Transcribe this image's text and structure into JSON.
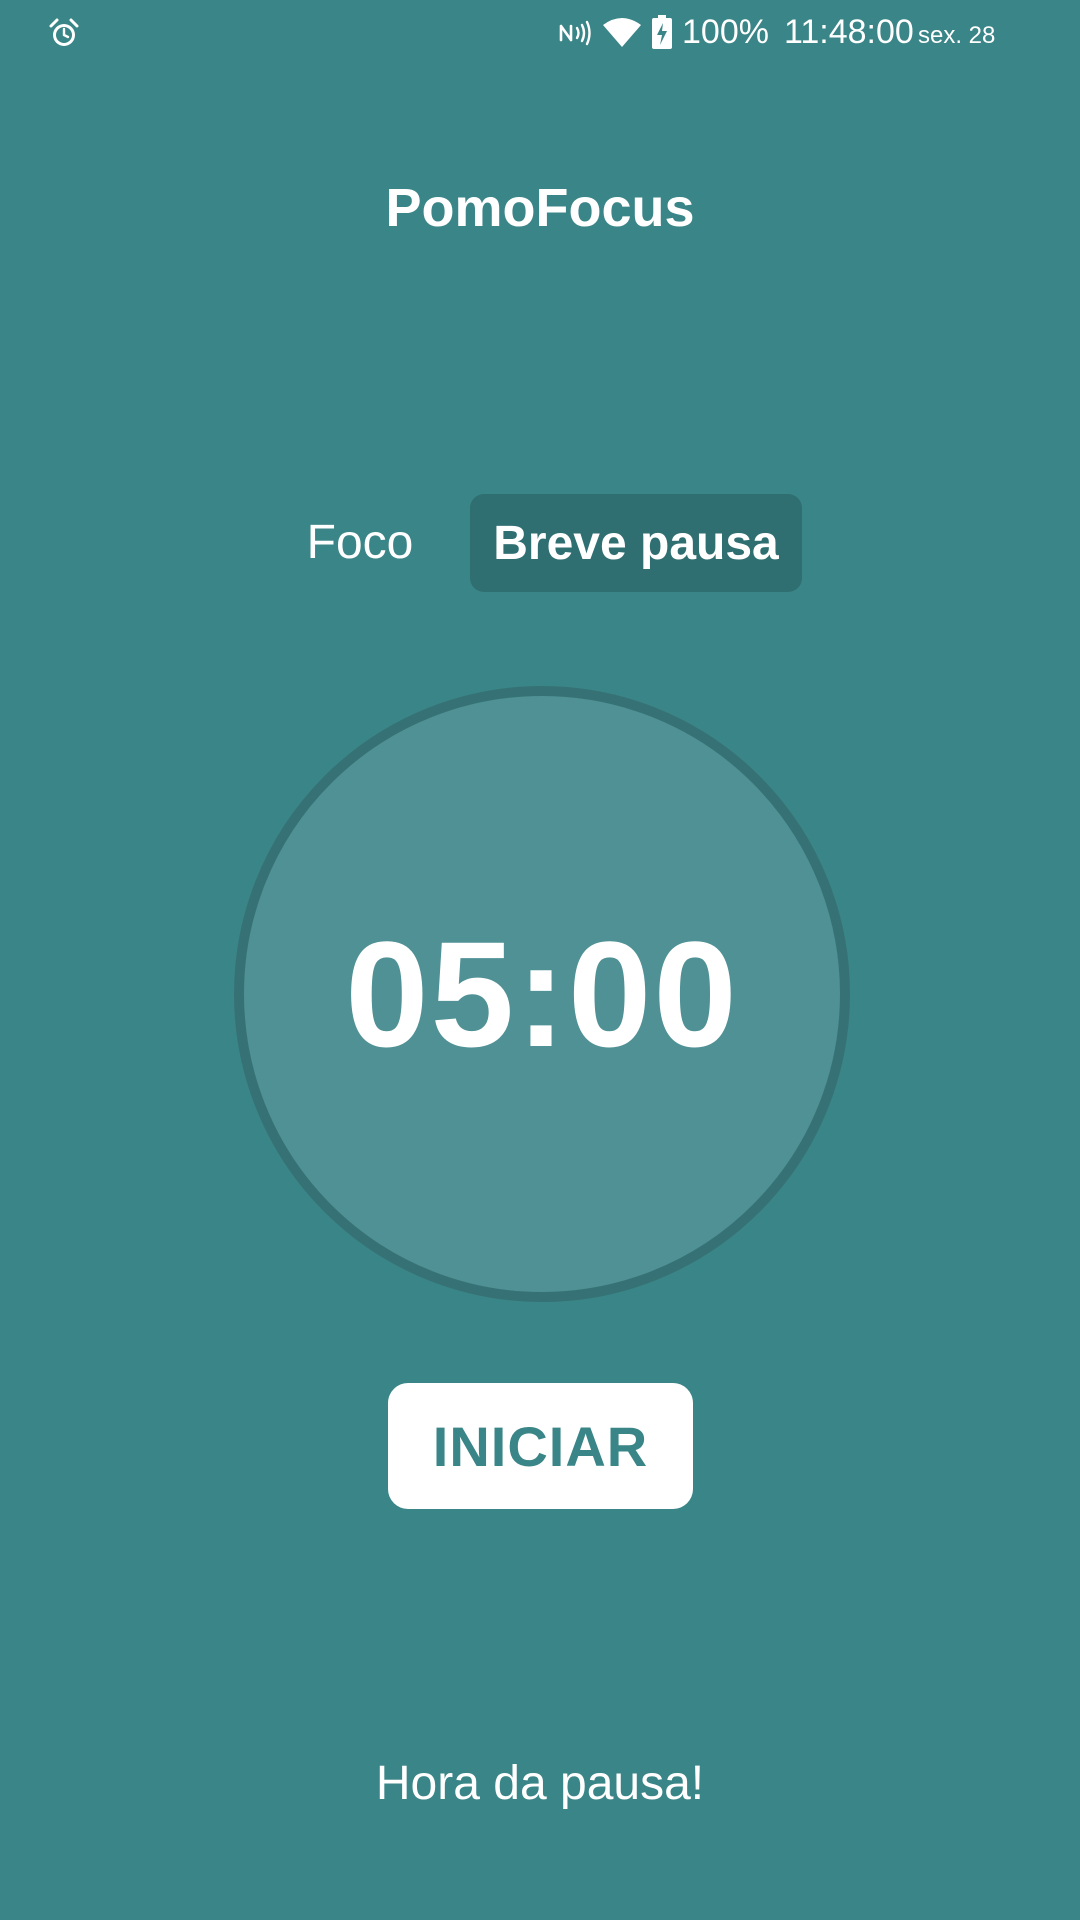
{
  "status_bar": {
    "icons": [
      "alarm-icon",
      "nfc-icon",
      "wifi-icon",
      "battery-charging-icon"
    ],
    "battery": "100%",
    "time": "11:48:00",
    "date": "sex. 28"
  },
  "header": {
    "title": "PomoFocus"
  },
  "modes": {
    "focus_label": "Foco",
    "short_break_label": "Breve pausa",
    "selected": "Breve pausa"
  },
  "timer": {
    "display": "05:00"
  },
  "controls": {
    "start_label": "INICIAR"
  },
  "message": {
    "text": "Hora da pausa!"
  },
  "colors": {
    "background": "#3a8587",
    "selected_tab": "#2f6e71",
    "timer_fill": "#4f9194",
    "timer_ring": "#367275",
    "button_text": "#3a8587"
  }
}
